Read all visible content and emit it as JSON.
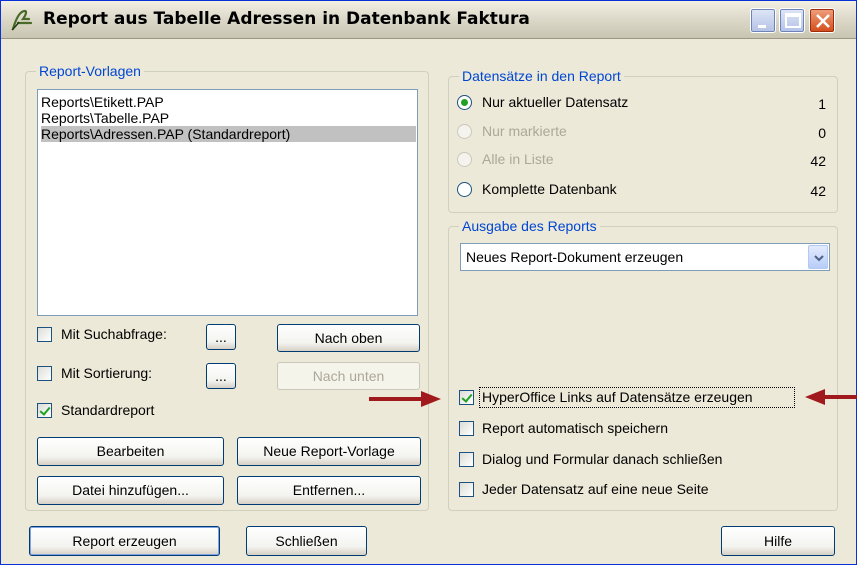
{
  "window": {
    "title": "Report aus Tabelle Adressen in Datenbank Faktura"
  },
  "vorlagen": {
    "legend": "Report-Vorlagen",
    "items": [
      "Reports\\Etikett.PAP",
      "Reports\\Tabelle.PAP",
      "Reports\\Adressen.PAP (Standardreport)"
    ],
    "selected_index": 2,
    "suchabfrage": {
      "label": "Mit Suchabfrage:",
      "checked": false,
      "button": "..."
    },
    "sortierung": {
      "label": "Mit Sortierung:",
      "checked": false,
      "button": "..."
    },
    "standardreport": {
      "label": "Standardreport",
      "checked": true
    },
    "nach_oben": "Nach oben",
    "nach_unten": "Nach unten",
    "bearbeiten": "Bearbeiten",
    "neue_vorlage": "Neue Report-Vorlage",
    "datei_hinzufuegen": "Datei hinzufügen...",
    "entfernen": "Entfernen..."
  },
  "datensaetze": {
    "legend": "Datensätze in den Report",
    "options": [
      {
        "label": "Nur aktueller Datensatz",
        "count": "1",
        "checked": true,
        "enabled": true
      },
      {
        "label": "Nur markierte",
        "count": "0",
        "checked": false,
        "enabled": false
      },
      {
        "label": "Alle in Liste",
        "count": "42",
        "checked": false,
        "enabled": false
      },
      {
        "label": "Komplette Datenbank",
        "count": "42",
        "checked": false,
        "enabled": true
      }
    ]
  },
  "ausgabe": {
    "legend": "Ausgabe des Reports",
    "selected": "Neues Report-Dokument erzeugen",
    "options": [
      {
        "label": "HyperOffice Links auf Datensätze erzeugen",
        "checked": true
      },
      {
        "label": "Report automatisch speichern",
        "checked": false
      },
      {
        "label": "Dialog und Formular danach schließen",
        "checked": false
      },
      {
        "label": "Jeder Datensatz auf eine neue Seite",
        "checked": false
      }
    ]
  },
  "footer": {
    "report_erzeugen": "Report erzeugen",
    "schliessen": "Schließen",
    "hilfe": "Hilfe"
  },
  "colors": {
    "accent": "#0046d5",
    "annotation_arrow": "#a0191c"
  }
}
